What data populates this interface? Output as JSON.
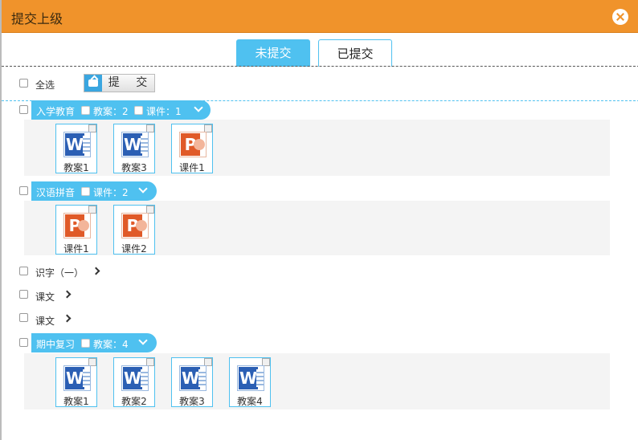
{
  "window": {
    "title": "提交上级"
  },
  "tabs": [
    {
      "label": "未提交",
      "active": true
    },
    {
      "label": "已提交",
      "active": false
    }
  ],
  "toolbar": {
    "select_all": "全选",
    "submit": "提 交"
  },
  "categories": [
    {
      "label": "入学教育",
      "counts": [
        "教案：2",
        "课件：1"
      ],
      "expanded": true,
      "files": [
        {
          "name": "教案1",
          "type": "W"
        },
        {
          "name": "教案3",
          "type": "W"
        },
        {
          "name": "课件1",
          "type": "P"
        }
      ]
    },
    {
      "label": "汉语拼音",
      "counts": [
        "课件：2"
      ],
      "expanded": true,
      "files": [
        {
          "name": "课件1",
          "type": "P"
        },
        {
          "name": "课件2",
          "type": "P"
        }
      ]
    },
    {
      "label": "识字（一）",
      "expanded": false
    },
    {
      "label": "课文",
      "expanded": false
    },
    {
      "label": "课文",
      "expanded": false
    },
    {
      "label": "期中复习",
      "counts": [
        "教案：4"
      ],
      "expanded": true,
      "files": [
        {
          "name": "教案1",
          "type": "W"
        },
        {
          "name": "教案2",
          "type": "W"
        },
        {
          "name": "教案3",
          "type": "W"
        },
        {
          "name": "教案4",
          "type": "W"
        }
      ]
    }
  ],
  "colors": {
    "titlebar": "#f0932b",
    "accent": "#4fc1f0"
  }
}
